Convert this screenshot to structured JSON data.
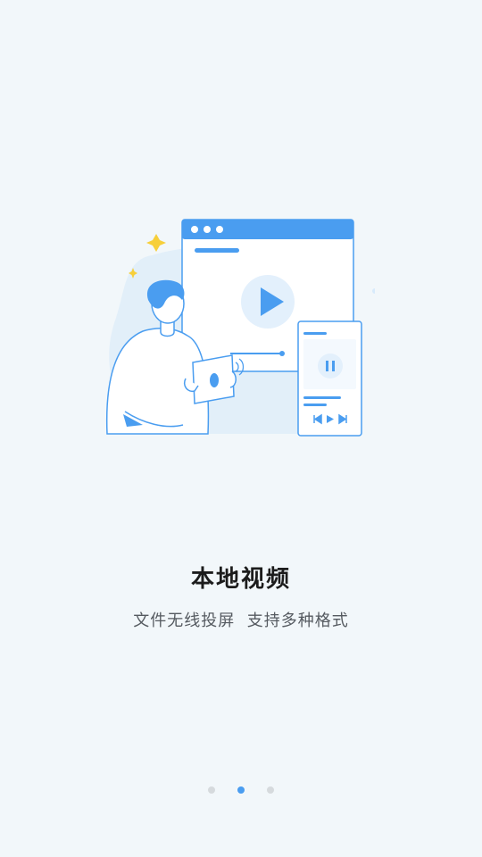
{
  "onboarding": {
    "title": "本地视频",
    "subtitle": "文件无线投屏  支持多种格式",
    "illustration_icon": "video-cast-illustration",
    "pager": {
      "count": 3,
      "active_index": 1
    }
  },
  "colors": {
    "background": "#f2f7fa",
    "accent": "#4a9df0",
    "accent_light": "#d8ebfb",
    "star": "#f7cf3a",
    "dot_inactive": "#d6dadd",
    "title": "#1c1c1c",
    "subtitle": "#555a60"
  }
}
